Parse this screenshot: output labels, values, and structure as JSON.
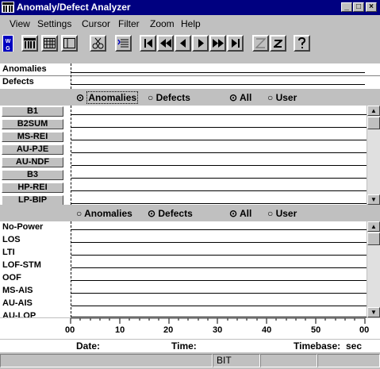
{
  "window": {
    "title": "Anomaly/Defect Analyzer",
    "controls": [
      "_",
      "□",
      "×"
    ]
  },
  "menu": [
    "View",
    "Settings",
    "Cursor",
    "Filter",
    "Zoom",
    "Help"
  ],
  "summary": {
    "rows": [
      "Anomalies",
      "Defects"
    ]
  },
  "anomaly_panel": {
    "radio_type": [
      "Anomalies",
      "Defects"
    ],
    "radio_type_selected": "Anomalies",
    "radio_scope": [
      "All",
      "User"
    ],
    "radio_scope_selected": "All",
    "rows": [
      "B1",
      "B2SUM",
      "MS-REI",
      "AU-PJE",
      "AU-NDF",
      "B3",
      "HP-REI",
      "LP-BIP"
    ]
  },
  "defect_panel": {
    "radio_type": [
      "Anomalies",
      "Defects"
    ],
    "radio_type_selected": "Defects",
    "radio_scope": [
      "All",
      "User"
    ],
    "radio_scope_selected": "All",
    "rows": [
      "No-Power",
      "LOS",
      "LTI",
      "LOF-STM",
      "OOF",
      "MS-AIS",
      "AU-AIS",
      "AU-LOP"
    ]
  },
  "time_axis": {
    "ticks": [
      "00",
      "10",
      "20",
      "30",
      "40",
      "50",
      "00"
    ]
  },
  "info": {
    "date_label": "Date:",
    "time_label": "Time:",
    "timebase_label": "Timebase:",
    "timebase_unit": "sec"
  },
  "statusbar": {
    "mode": "BIT"
  },
  "icons": [
    "app-logo-icon",
    "wg-icon",
    "cabinet-icon",
    "grid-icon",
    "window-icon",
    "scissors-icon",
    "list-icon",
    "first-icon",
    "rewind-icon",
    "prev-icon",
    "next-icon",
    "fast-forward-icon",
    "last-icon",
    "zoom-out-icon",
    "zoom-in-icon",
    "help-icon"
  ]
}
